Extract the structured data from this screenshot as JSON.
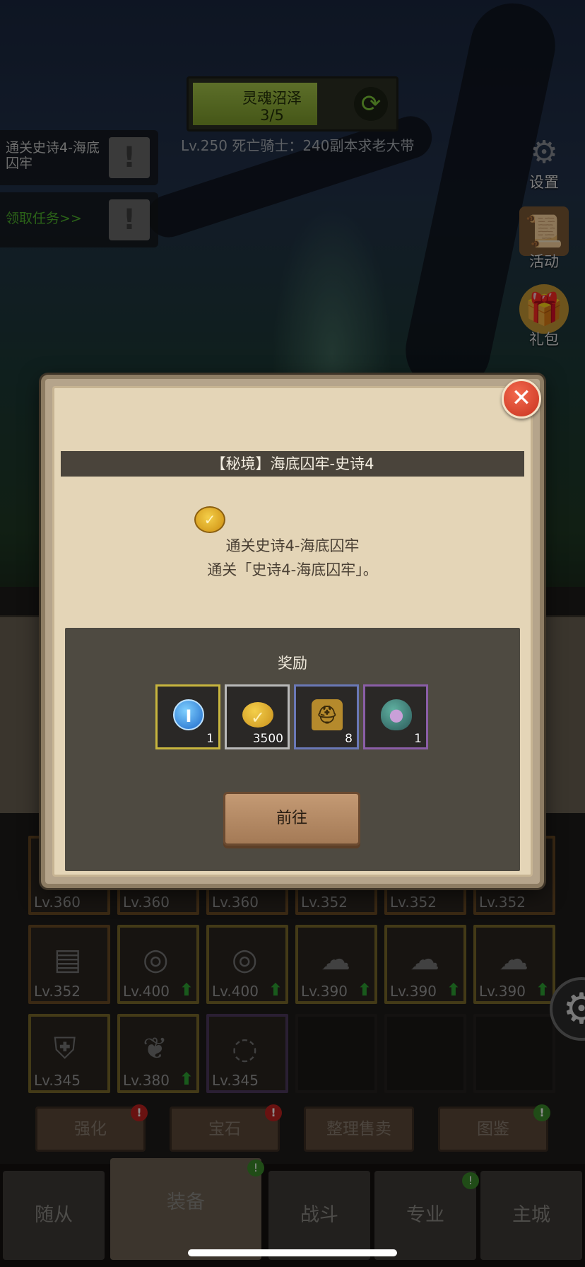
{
  "zone": {
    "name": "灵魂沼泽",
    "progress": "3/5",
    "fill_fraction": 0.6
  },
  "boss_line": "Lv.250 死亡骑士：240副本求老大带",
  "quests": [
    {
      "text": "通关史诗4-海底囚牢",
      "badge": "!"
    },
    {
      "text": "领取任务>>",
      "badge": "!"
    }
  ],
  "side_menu": {
    "settings": "设置",
    "activity": "活动",
    "gift": "礼包"
  },
  "dialog": {
    "title": "【秘境】海底囚牢-史诗4",
    "task_name": "通关史诗4-海底囚牢",
    "task_desc": "通关「史诗4-海底囚牢」。",
    "reward_title": "奖励",
    "rewards": [
      {
        "icon": "blue-token-icon",
        "qty": "1"
      },
      {
        "icon": "gold-coin-icon",
        "qty": "3500"
      },
      {
        "icon": "helmet-icon",
        "qty": "8"
      },
      {
        "icon": "pet-egg-icon",
        "qty": "1"
      }
    ],
    "go_label": "前往",
    "close_glyph": "✕"
  },
  "equipment": {
    "row1": [
      "Lv.360",
      "Lv.360",
      "Lv.360",
      "Lv.352",
      "Lv.352",
      "Lv.352"
    ],
    "row2": [
      "Lv.352",
      "Lv.400",
      "Lv.400",
      "Lv.390",
      "Lv.390",
      "Lv.390"
    ],
    "row3": [
      "Lv.345",
      "Lv.380",
      "Lv.345"
    ]
  },
  "actions": {
    "enhance": "强化",
    "gem": "宝石",
    "sort_sell": "整理售卖",
    "codex": "图鉴"
  },
  "nav": {
    "followers": "随从",
    "equipment": "装备",
    "battle": "战斗",
    "profession": "专业",
    "city": "主城"
  }
}
